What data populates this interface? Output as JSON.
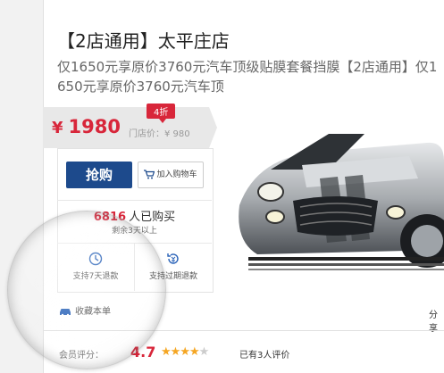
{
  "deal": {
    "title": "【2店通用】太平庄店",
    "subtitle": "仅1650元享原价3760元汽车顶级贴膜套餐挡膜【2店通用】仅1650元享原价3760元汽车顶",
    "discount_badge": "4折",
    "price_symbol": "¥",
    "price": "1980",
    "original_price": "门店价：¥ 980"
  },
  "actions": {
    "buy_label": "抢购",
    "cart_label": "加入购物车"
  },
  "stats": {
    "sold_count": "6816",
    "sold_suffix": "人已购买",
    "remaining": "剩余3天以上"
  },
  "guarantees": [
    {
      "label": "支持7天退款",
      "icon": "clock-icon"
    },
    {
      "label": "支持过期退款",
      "icon": "refund-icon"
    }
  ],
  "favorite_label": "收藏本单",
  "share_label": "分享",
  "rating": {
    "label": "会员评分：",
    "score": "4.7",
    "stars_filled": 4,
    "stars_total": 5,
    "reviews": "已有3人评价"
  },
  "colors": {
    "accent_red": "#d8263a",
    "buy_blue": "#1d4a8c",
    "star": "#f5a623"
  }
}
